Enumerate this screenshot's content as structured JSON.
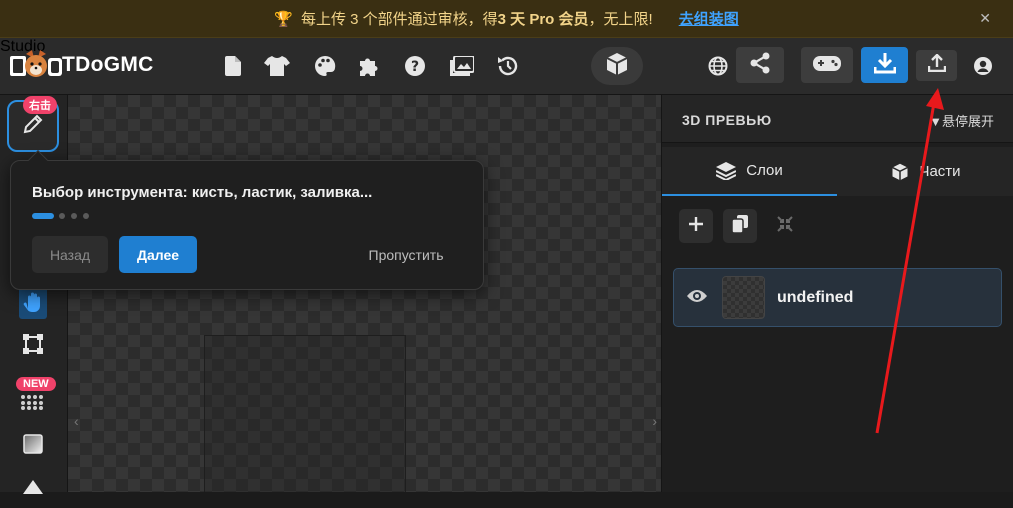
{
  "banner": {
    "text_prefix": "每上传 3 个部件通过审核，得 ",
    "bold": "3 天 Pro 会员",
    "text_suffix": "，无上限!",
    "link": "去组装图",
    "close": "✕"
  },
  "logo": {
    "name": "TDoGMC",
    "studio": "Studio"
  },
  "left_tools": {
    "active_badge": "右击",
    "new_badge": "NEW"
  },
  "tour": {
    "text": "Выбор инструмента: кисть, ластик, заливка...",
    "back": "Назад",
    "next": "Далее",
    "skip": "Пропустить",
    "step": 1,
    "total_steps": 4
  },
  "right_panel": {
    "title": "3D ПРЕВЬЮ",
    "hover_toggle": "▼悬停展开",
    "tabs": [
      {
        "label": "Слои",
        "icon": "layers-icon",
        "active": true
      },
      {
        "label": "Части",
        "icon": "cube-icon",
        "active": false
      }
    ],
    "layers": [
      {
        "name": "undefined",
        "visible": true
      }
    ]
  },
  "colors": {
    "accent": "#2c8fe0",
    "badge": "#f0426a",
    "banner_bg": "#3a2f12",
    "annotation_arrow": "#e8191c"
  }
}
